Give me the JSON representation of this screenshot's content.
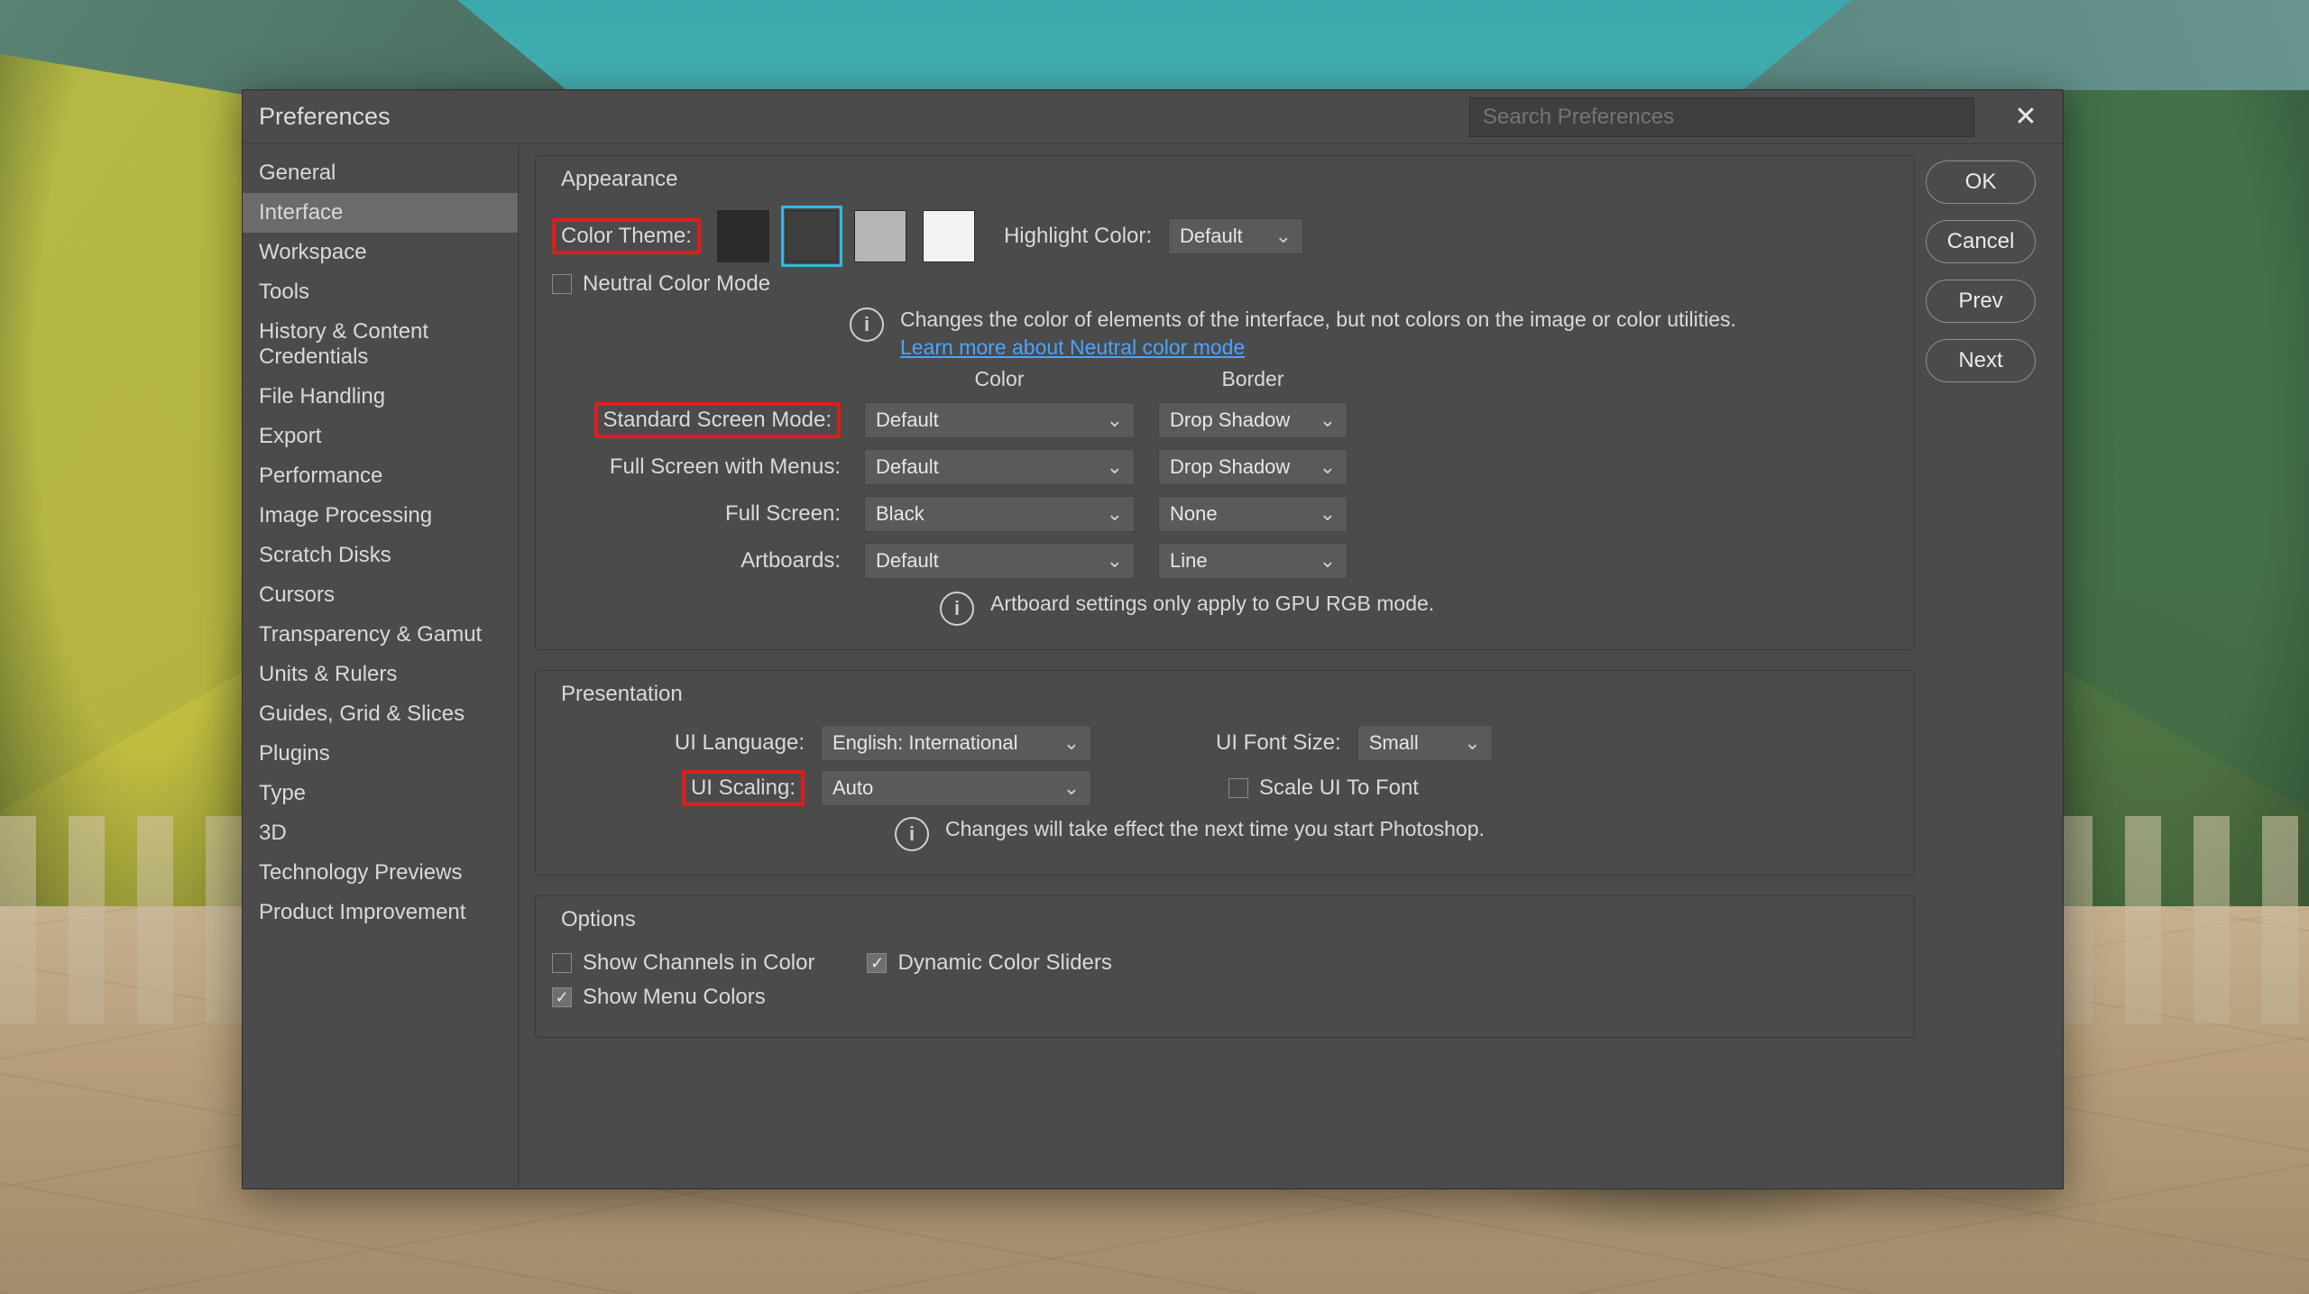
{
  "window": {
    "title": "Preferences",
    "search_placeholder": "Search Preferences"
  },
  "buttons": {
    "ok": "OK",
    "cancel": "Cancel",
    "prev": "Prev",
    "next": "Next"
  },
  "sidebar": {
    "items": [
      {
        "label": "General"
      },
      {
        "label": "Interface"
      },
      {
        "label": "Workspace"
      },
      {
        "label": "Tools"
      },
      {
        "label": "History & Content Credentials"
      },
      {
        "label": "File Handling"
      },
      {
        "label": "Export"
      },
      {
        "label": "Performance"
      },
      {
        "label": "Image Processing"
      },
      {
        "label": "Scratch Disks"
      },
      {
        "label": "Cursors"
      },
      {
        "label": "Transparency & Gamut"
      },
      {
        "label": "Units & Rulers"
      },
      {
        "label": "Guides, Grid & Slices"
      },
      {
        "label": "Plugins"
      },
      {
        "label": "Type"
      },
      {
        "label": "3D"
      },
      {
        "label": "Technology Previews"
      },
      {
        "label": "Product Improvement"
      }
    ],
    "selected_index": 1
  },
  "appearance": {
    "legend": "Appearance",
    "color_theme_label": "Color Theme:",
    "highlight_color_label": "Highlight Color:",
    "highlight_color_value": "Default",
    "theme_swatches": [
      "#2a2a2a",
      "#3e3e3e",
      "#b6b6b6",
      "#f2f2f2"
    ],
    "theme_selected_index": 1,
    "neutral_label": "Neutral Color Mode",
    "neutral_info": "Changes the color of elements of the interface, but not colors on the image or color utilities.",
    "neutral_link": "Learn more about Neutral color mode",
    "col_hdr_color": "Color",
    "col_hdr_border": "Border",
    "rows": [
      {
        "label": "Standard Screen Mode:",
        "color": "Default",
        "border": "Drop Shadow",
        "outlined": true
      },
      {
        "label": "Full Screen with Menus:",
        "color": "Default",
        "border": "Drop Shadow"
      },
      {
        "label": "Full Screen:",
        "color": "Black",
        "border": "None"
      },
      {
        "label": "Artboards:",
        "color": "Default",
        "border": "Line"
      }
    ],
    "artboard_note": "Artboard settings only apply to GPU RGB mode."
  },
  "presentation": {
    "legend": "Presentation",
    "ui_language_label": "UI Language:",
    "ui_language_value": "English: International",
    "ui_font_size_label": "UI Font Size:",
    "ui_font_size_value": "Small",
    "ui_scaling_label": "UI Scaling:",
    "ui_scaling_value": "Auto",
    "scale_ui_to_font_label": "Scale UI To Font",
    "restart_note": "Changes will take effect the next time you start Photoshop."
  },
  "options": {
    "legend": "Options",
    "show_channels_label": "Show Channels in Color",
    "dynamic_sliders_label": "Dynamic Color Sliders",
    "show_menu_colors_label": "Show Menu Colors"
  }
}
